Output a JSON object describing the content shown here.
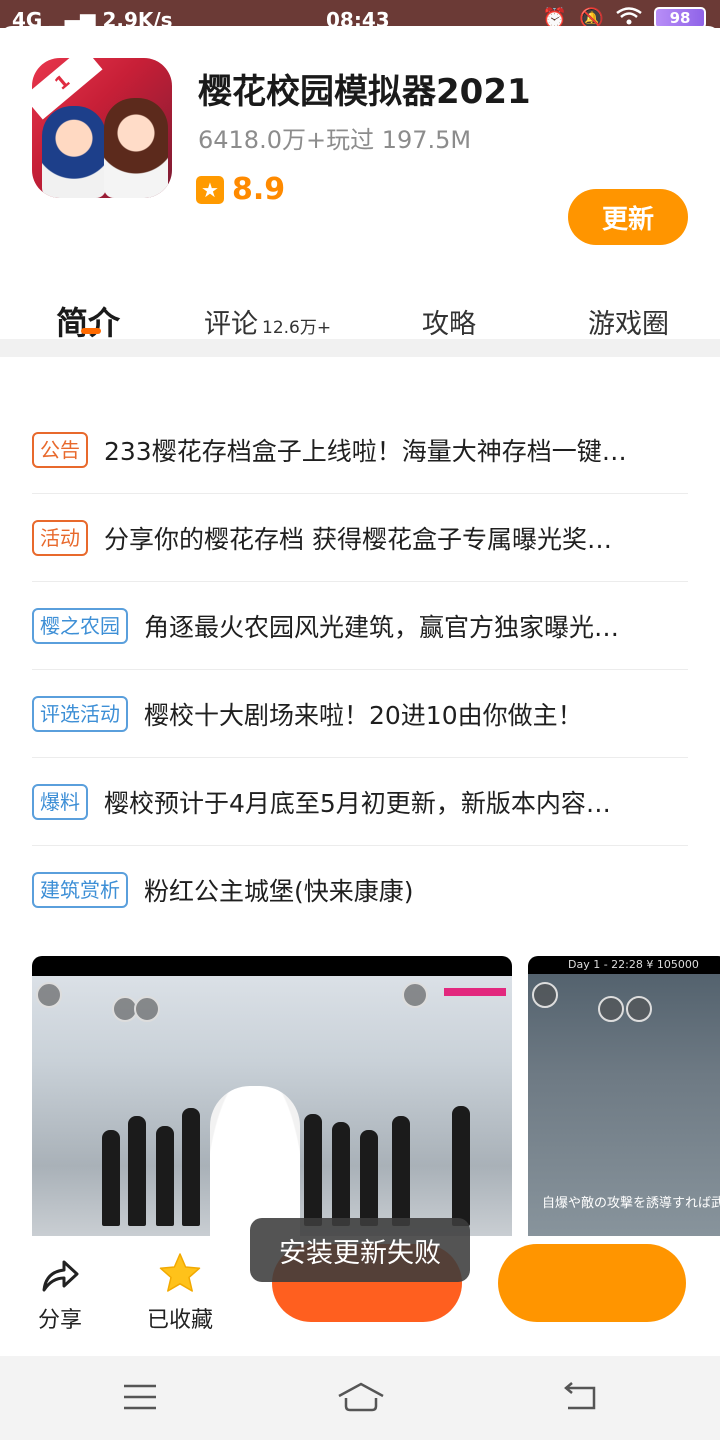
{
  "status_bar": {
    "network": "4G",
    "speed": "2.9K/s",
    "time": "08:43",
    "battery": "98"
  },
  "app": {
    "title": "樱花校园模拟器2021",
    "meta": "6418.0万+玩过  197.5M",
    "rating": "8.9",
    "update_label": "更新",
    "icon_badge": "1"
  },
  "tabs": [
    {
      "label": "简介",
      "active": true
    },
    {
      "label": "评论",
      "count": "12.6万+"
    },
    {
      "label": "攻略"
    },
    {
      "label": "游戏圈"
    }
  ],
  "news": [
    {
      "tag": "公告",
      "tag_color": "orange",
      "text": "233樱花存档盒子上线啦！海量大神存档一键…"
    },
    {
      "tag": "活动",
      "tag_color": "orange",
      "text": "分享你的樱花存档 获得樱花盒子专属曝光奖…"
    },
    {
      "tag": "樱之农园",
      "tag_color": "blue",
      "text": "角逐最火农园风光建筑，赢官方独家曝光…"
    },
    {
      "tag": "评选活动",
      "tag_color": "blue",
      "text": "樱校十大剧场来啦！20进10由你做主！"
    },
    {
      "tag": "爆料",
      "tag_color": "blue",
      "text": "樱校预计于4月底至5月初更新，新版本内容…"
    },
    {
      "tag": "建筑赏析",
      "tag_color": "blue",
      "text": "粉红公主城堡(快来康康)"
    }
  ],
  "screenshots": {
    "second_hud": "Day 1 - 22:28 ¥ 105000",
    "second_caption": "自爆や敵の攻撃を誘導すれば武器"
  },
  "bottom_actions": {
    "share_label": "分享",
    "favorite_label": "已收藏"
  },
  "toast": "安装更新失败",
  "colors": {
    "accent_orange": "#ff9500",
    "tab_indicator": "#ff6a00",
    "tag_orange": "#e8692c",
    "tag_blue": "#3d8fd6",
    "star_gold": "#ffc21a"
  }
}
